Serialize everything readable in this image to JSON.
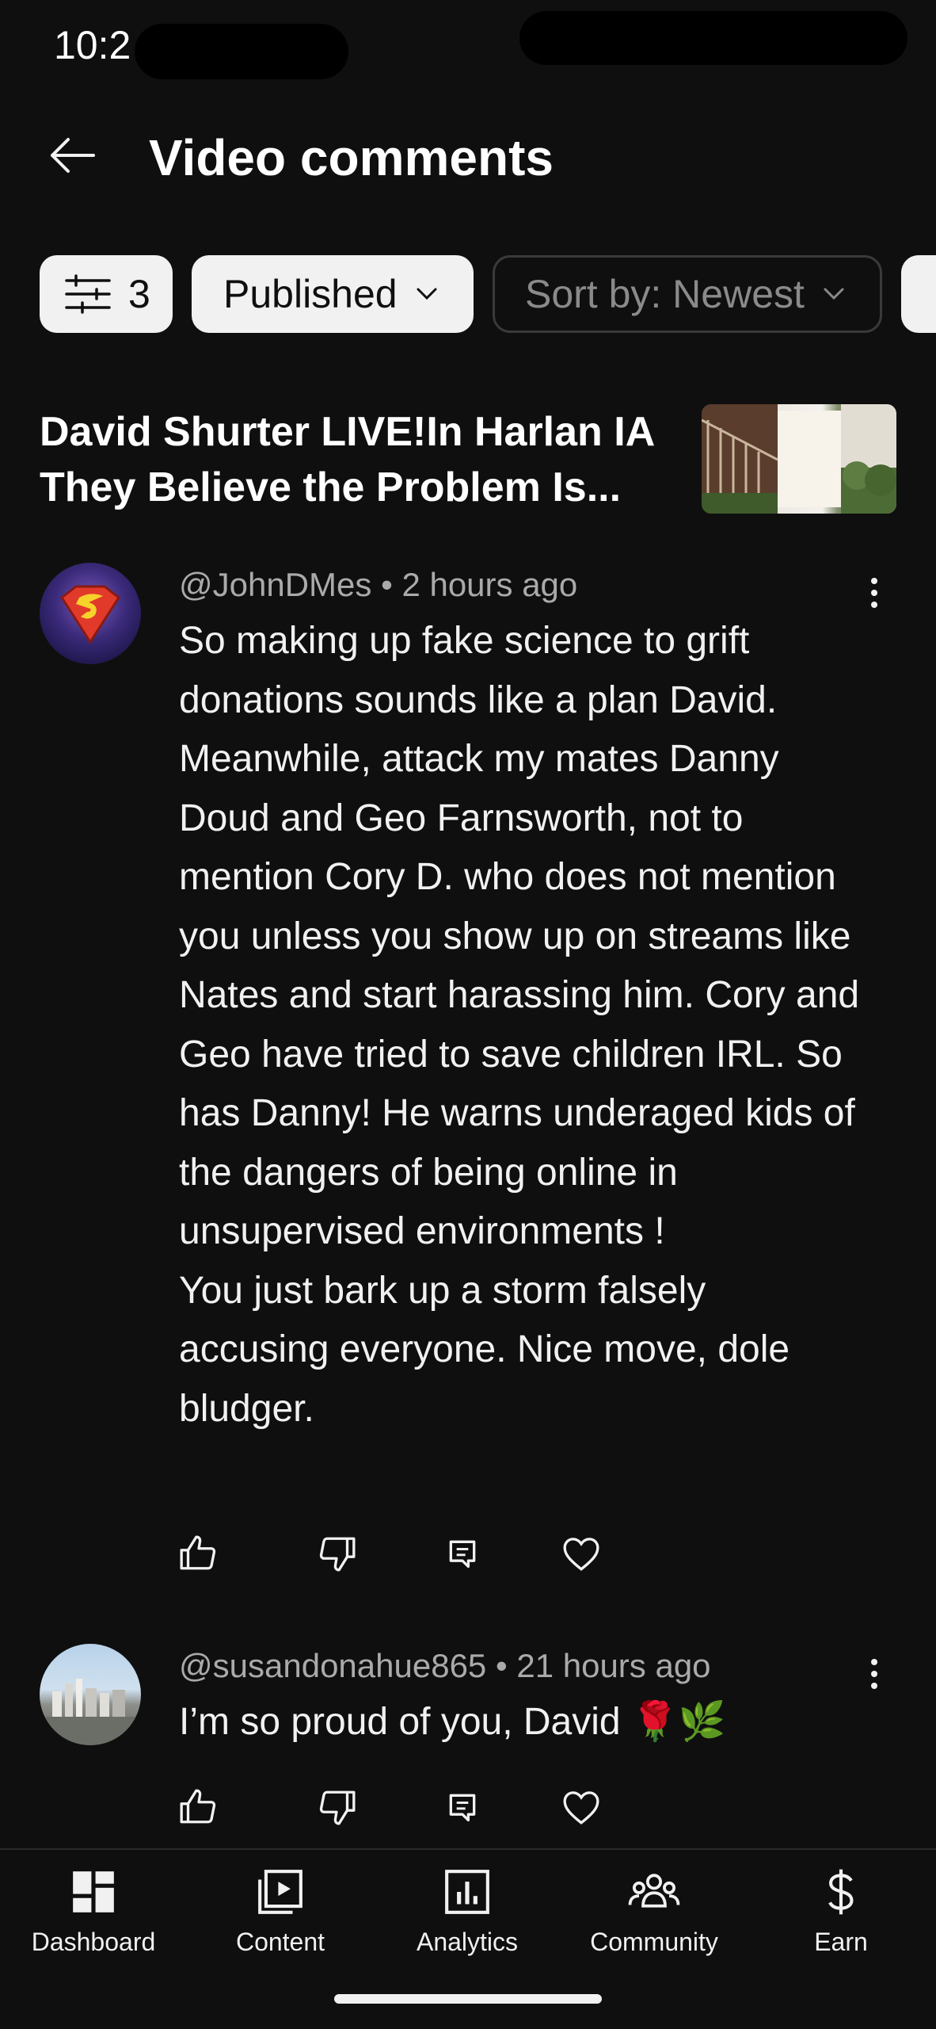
{
  "status_bar": {
    "time": "10:2"
  },
  "header": {
    "title": "Video comments"
  },
  "filters": {
    "filter_count": "3",
    "status": "Published",
    "sort": "Sort by: Newest"
  },
  "video": {
    "title": "David Shurter LIVE!In Harlan IA They Believe the Problem Is..."
  },
  "comments": [
    {
      "author": "@JohnDMes",
      "time": "2 hours ago",
      "text": "So making up fake science to grift donations sounds like a plan David. Meanwhile, attack my mates Danny Doud and Geo Farnsworth, not to mention Cory D. who does not mention you unless you show up on streams like Nates and start harassing him. Cory and Geo have tried to save children IRL. So has Danny! He warns underaged kids of the dangers of being online in unsupervised environments !\nYou just bark up a storm falsely accusing everyone. Nice move, dole bludger."
    },
    {
      "author": "@susandonahue865",
      "time": "21 hours ago",
      "text": "I’m so proud of you, David 🌹🌿"
    }
  ],
  "bottom_nav": {
    "items": [
      {
        "label": "Dashboard",
        "icon": "dashboard-icon"
      },
      {
        "label": "Content",
        "icon": "content-icon"
      },
      {
        "label": "Analytics",
        "icon": "analytics-icon"
      },
      {
        "label": "Community",
        "icon": "community-icon"
      },
      {
        "label": "Earn",
        "icon": "earn-icon"
      }
    ]
  },
  "colors": {
    "background": "#0f0f0f",
    "text": "#f1f1f1",
    "secondary_text": "#aaaaaa",
    "chip_light": "#f1f1f1"
  }
}
